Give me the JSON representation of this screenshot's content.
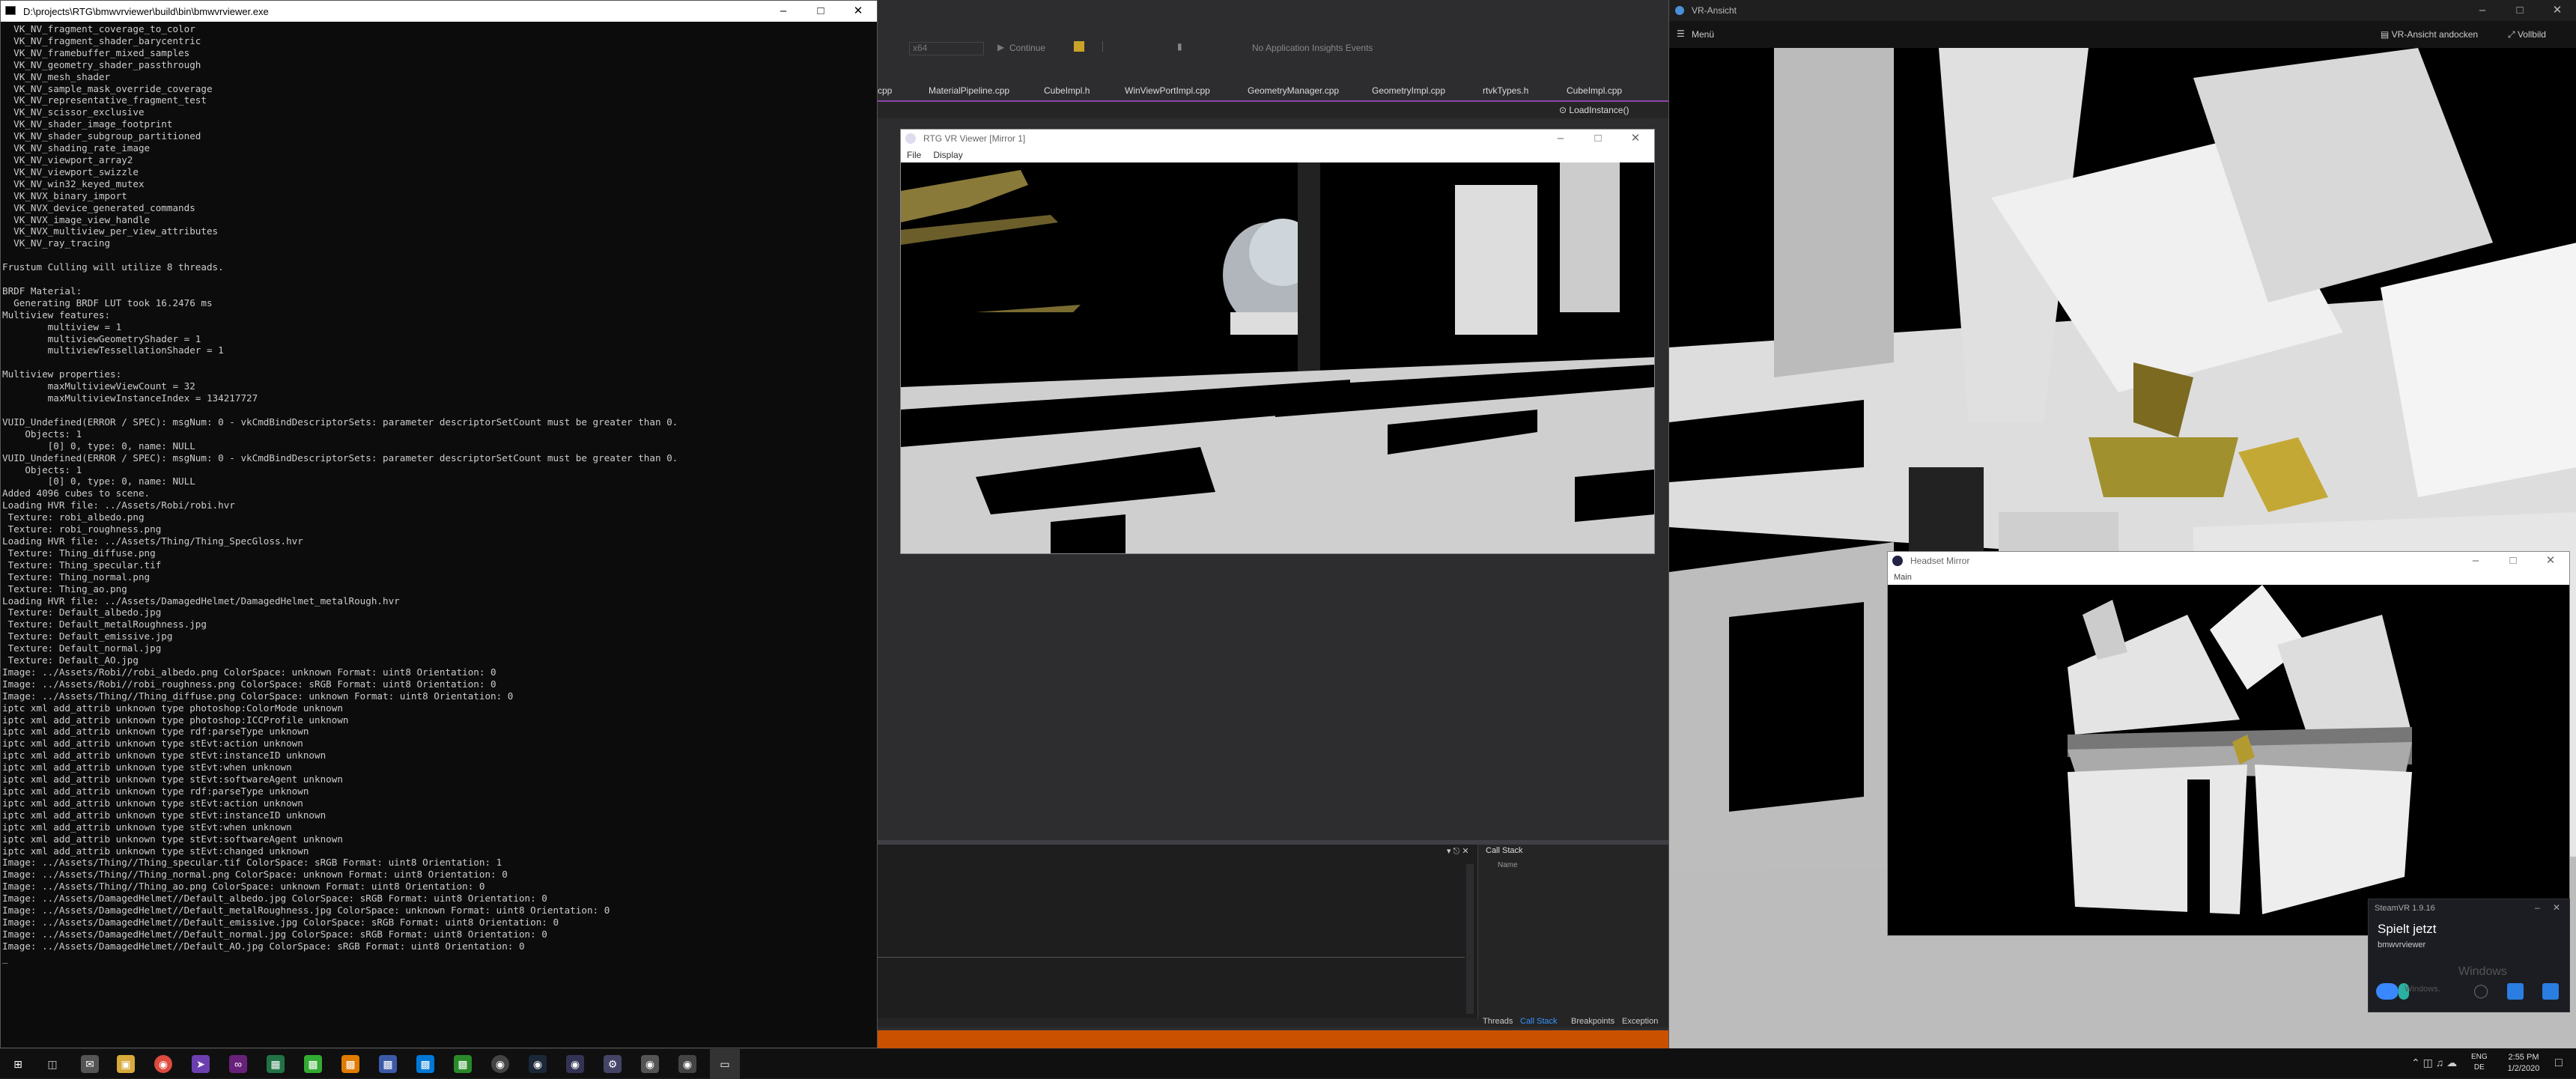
{
  "console": {
    "title": "D:\\projects\\RTG\\bmwvrviewer\\build\\bin\\bmwvrviewer.exe",
    "lines": [
      "  VK_NV_fragment_coverage_to_color",
      "  VK_NV_fragment_shader_barycentric",
      "  VK_NV_framebuffer_mixed_samples",
      "  VK_NV_geometry_shader_passthrough",
      "  VK_NV_mesh_shader",
      "  VK_NV_sample_mask_override_coverage",
      "  VK_NV_representative_fragment_test",
      "  VK_NV_scissor_exclusive",
      "  VK_NV_shader_image_footprint",
      "  VK_NV_shader_subgroup_partitioned",
      "  VK_NV_shading_rate_image",
      "  VK_NV_viewport_array2",
      "  VK_NV_viewport_swizzle",
      "  VK_NV_win32_keyed_mutex",
      "  VK_NVX_binary_import",
      "  VK_NVX_device_generated_commands",
      "  VK_NVX_image_view_handle",
      "  VK_NVX_multiview_per_view_attributes",
      "  VK_NV_ray_tracing",
      "",
      "Frustum Culling will utilize 8 threads.",
      "",
      "BRDF Material:",
      "  Generating BRDF LUT took 16.2476 ms",
      "Multiview features:",
      "        multiview = 1",
      "        multiviewGeometryShader = 1",
      "        multiviewTessellationShader = 1",
      "",
      "Multiview properties:",
      "        maxMultiviewViewCount = 32",
      "        maxMultiviewInstanceIndex = 134217727",
      "",
      "VUID_Undefined(ERROR / SPEC): msgNum: 0 - vkCmdBindDescriptorSets: parameter descriptorSetCount must be greater than 0.",
      "    Objects: 1",
      "        [0] 0, type: 0, name: NULL",
      "VUID_Undefined(ERROR / SPEC): msgNum: 0 - vkCmdBindDescriptorSets: parameter descriptorSetCount must be greater than 0.",
      "    Objects: 1",
      "        [0] 0, type: 0, name: NULL",
      "Added 4096 cubes to scene.",
      "Loading HVR file: ../Assets/Robi/robi.hvr",
      " Texture: robi_albedo.png",
      " Texture: robi_roughness.png",
      "Loading HVR file: ../Assets/Thing/Thing_SpecGloss.hvr",
      " Texture: Thing_diffuse.png",
      " Texture: Thing_specular.tif",
      " Texture: Thing_normal.png",
      " Texture: Thing_ao.png",
      "Loading HVR file: ../Assets/DamagedHelmet/DamagedHelmet_metalRough.hvr",
      " Texture: Default_albedo.jpg",
      " Texture: Default_metalRoughness.jpg",
      " Texture: Default_emissive.jpg",
      " Texture: Default_normal.jpg",
      " Texture: Default_AO.jpg",
      "Image: ../Assets/Robi//robi_albedo.png ColorSpace: unknown Format: uint8 Orientation: 0",
      "Image: ../Assets/Robi//robi_roughness.png ColorSpace: sRGB Format: uint8 Orientation: 0",
      "Image: ../Assets/Thing//Thing_diffuse.png ColorSpace: unknown Format: uint8 Orientation: 0",
      "iptc xml add_attrib unknown type photoshop:ColorMode unknown",
      "iptc xml add_attrib unknown type photoshop:ICCProfile unknown",
      "iptc xml add_attrib unknown type rdf:parseType unknown",
      "iptc xml add_attrib unknown type stEvt:action unknown",
      "iptc xml add_attrib unknown type stEvt:instanceID unknown",
      "iptc xml add_attrib unknown type stEvt:when unknown",
      "iptc xml add_attrib unknown type stEvt:softwareAgent unknown",
      "iptc xml add_attrib unknown type rdf:parseType unknown",
      "iptc xml add_attrib unknown type stEvt:action unknown",
      "iptc xml add_attrib unknown type stEvt:instanceID unknown",
      "iptc xml add_attrib unknown type stEvt:when unknown",
      "iptc xml add_attrib unknown type stEvt:softwareAgent unknown",
      "iptc xml add_attrib unknown type stEvt:changed unknown",
      "Image: ../Assets/Thing//Thing_specular.tif ColorSpace: sRGB Format: uint8 Orientation: 1",
      "Image: ../Assets/Thing//Thing_normal.png ColorSpace: unknown Format: uint8 Orientation: 0",
      "Image: ../Assets/Thing//Thing_ao.png ColorSpace: unknown Format: uint8 Orientation: 0",
      "Image: ../Assets/DamagedHelmet//Default_albedo.jpg ColorSpace: sRGB Format: uint8 Orientation: 0",
      "Image: ../Assets/DamagedHelmet//Default_metalRoughness.jpg ColorSpace: unknown Format: uint8 Orientation: 0",
      "Image: ../Assets/DamagedHelmet//Default_emissive.jpg ColorSpace: sRGB Format: uint8 Orientation: 0",
      "Image: ../Assets/DamagedHelmet//Default_normal.jpg ColorSpace: sRGB Format: uint8 Orientation: 0",
      "Image: ../Assets/DamagedHelmet//Default_AO.jpg ColorSpace: sRGB Format: uint8 Orientation: 0",
      "_"
    ]
  },
  "vs": {
    "toolbar": {
      "platform": "x64",
      "continue": "Continue",
      "insights": "No Application Insights Events"
    },
    "tabs": [
      "cpp",
      "MaterialPipeline.cpp",
      "CubeImpl.h",
      "WinViewPortImpl.cpp",
      "GeometryManager.cpp",
      "GeometryImpl.cpp",
      "rtvkTypes.h",
      "CubeImpl.cpp"
    ],
    "member": "LoadInstance()",
    "callstack": {
      "title": "Call Stack",
      "column": "Name"
    },
    "bottom_tabs": [
      "Threads",
      "Call Stack",
      "Breakpoints",
      "Exception"
    ]
  },
  "rtg": {
    "title": "RTG VR Viewer [Mirror 1]",
    "menu": [
      "File",
      "Display"
    ]
  },
  "vr": {
    "title": "VR-Ansicht",
    "menu": "Menü",
    "dock": "VR-Ansicht andocken",
    "fullscreen": "Vollbild"
  },
  "headset": {
    "title": "Headset Mirror",
    "menu": "Main"
  },
  "steamvr": {
    "title": "SteamVR 1.9.16",
    "status": "Spielt jetzt",
    "app": "bmwvrviewer",
    "watermark_1": "Windows",
    "watermark_2": "Windows."
  },
  "taskbar": {
    "lang1": "ENG",
    "lang2": "DE",
    "time": "2:55 PM",
    "date": "1/2/2020"
  }
}
